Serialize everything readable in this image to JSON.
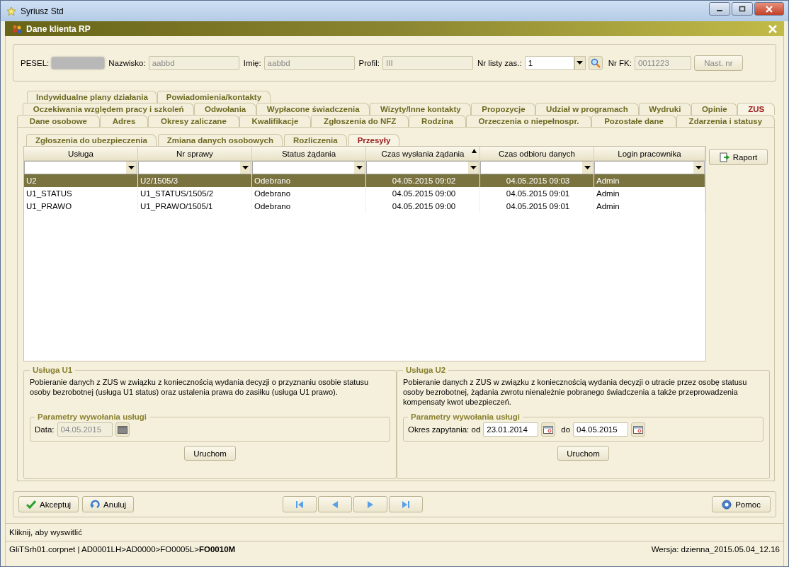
{
  "window": {
    "title": "Syriusz Std"
  },
  "dialog": {
    "title": "Dane klienta RP"
  },
  "header": {
    "pesel_label": "PESEL:",
    "surname_label": "Nazwisko:",
    "surname": "aabbd",
    "name_label": "Imię:",
    "name": "aabbd",
    "profile_label": "Profil:",
    "profile": "III",
    "list_label": "Nr listy zas.:",
    "list_value": "1",
    "fk_label": "Nr FK:",
    "fk": "0011223",
    "next_button": "Nast. nr"
  },
  "tab_rows": [
    [
      {
        "label": "Indywidualne plany działania",
        "selected": false
      },
      {
        "label": "Powiadomienia/kontakty",
        "selected": false
      }
    ],
    [
      {
        "label": "Oczekiwania względem pracy i szkoleń",
        "selected": false
      },
      {
        "label": "Odwołania",
        "selected": false
      },
      {
        "label": "Wypłacone świadczenia",
        "selected": false
      },
      {
        "label": "Wizyty/Inne kontakty",
        "selected": false
      },
      {
        "label": "Propozycje",
        "selected": false
      },
      {
        "label": "Udział w programach",
        "selected": false
      },
      {
        "label": "Wydruki",
        "selected": false
      },
      {
        "label": "Opinie",
        "selected": false
      },
      {
        "label": "ZUS",
        "selected": true
      }
    ],
    [
      {
        "label": "Dane osobowe",
        "selected": false
      },
      {
        "label": "Adres",
        "selected": false
      },
      {
        "label": "Okresy zaliczane",
        "selected": false
      },
      {
        "label": "Kwalifikacje",
        "selected": false
      },
      {
        "label": "Zgłoszenia do NFZ",
        "selected": false
      },
      {
        "label": "Rodzina",
        "selected": false
      },
      {
        "label": "Orzeczenia o niepełnospr.",
        "selected": false
      },
      {
        "label": "Pozostałe dane",
        "selected": false
      },
      {
        "label": "Zdarzenia i statusy",
        "selected": false
      }
    ]
  ],
  "subtabs": [
    {
      "label": "Zgłoszenia do ubezpieczenia",
      "selected": false
    },
    {
      "label": "Zmiana danych osobowych",
      "selected": false
    },
    {
      "label": "Rozliczenia",
      "selected": false
    },
    {
      "label": "Przesyły",
      "selected": true
    }
  ],
  "table": {
    "columns": [
      {
        "label": "Usługa",
        "sorted": false,
        "kind": "text"
      },
      {
        "label": "Nr sprawy",
        "sorted": false,
        "kind": "text"
      },
      {
        "label": "Status żądania",
        "sorted": false,
        "kind": "text"
      },
      {
        "label": "Czas wysłania żądania",
        "sorted": true,
        "kind": "datetime"
      },
      {
        "label": "Czas odbioru danych",
        "sorted": false,
        "kind": "datetime"
      },
      {
        "label": "Login pracownika",
        "sorted": false,
        "kind": "text"
      }
    ],
    "rows": [
      {
        "selected": true,
        "cells": [
          "U2",
          "U2/1505/3",
          "Odebrano",
          "04.05.2015 09:02",
          "04.05.2015 09:03",
          "Admin"
        ]
      },
      {
        "selected": false,
        "cells": [
          "U1_STATUS",
          "U1_STATUS/1505/2",
          "Odebrano",
          "04.05.2015 09:00",
          "04.05.2015 09:01",
          "Admin"
        ]
      },
      {
        "selected": false,
        "cells": [
          "U1_PRAWO",
          "U1_PRAWO/1505/1",
          "Odebrano",
          "04.05.2015 09:00",
          "04.05.2015 09:01",
          "Admin"
        ]
      }
    ]
  },
  "report_button": "Raport",
  "services": [
    {
      "kind": "single",
      "title": "Usługa U1",
      "description": "Pobieranie danych z ZUS w związku z koniecznością wydania decyzji o przyznaniu osobie statusu osoby bezrobotnej (usługa U1 status) oraz ustalenia prawa do zasiłku (usługa U1 prawo).",
      "params_title": "Parametry wywołania usługi",
      "label": "Data:",
      "dates": [
        {
          "value": "04.05.2015",
          "disabled": true
        }
      ],
      "run_button": "Uruchom"
    },
    {
      "kind": "range",
      "title": "Usługa U2",
      "description": "Pobieranie danych z ZUS w związku z koniecznością wydania decyzji o utracie przez osobę statusu osoby bezrobotnej, żądania zwrotu nienależnie pobranego świadczenia a także przeprowadzenia kompensaty kwot ubezpieczeń.",
      "params_title": "Parametry wywołania usługi",
      "label": "Okres zapytania: od",
      "between": "do",
      "dates": [
        {
          "value": "23.01.2014",
          "disabled": false
        },
        {
          "value": "04.05.2015",
          "disabled": false
        }
      ],
      "run_button": "Uruchom"
    }
  ],
  "buttons": {
    "accept": "Akceptuj",
    "cancel": "Anuluj",
    "help": "Pomoc"
  },
  "hint": "Kliknij, aby wyswitlić",
  "status_bar": {
    "path": "GliTSrh01.corpnet | AD0001LH>AD0000>FO0005L>**FO0010M**",
    "version": "Wersja: dzienna_2015.05.04_12.16"
  }
}
